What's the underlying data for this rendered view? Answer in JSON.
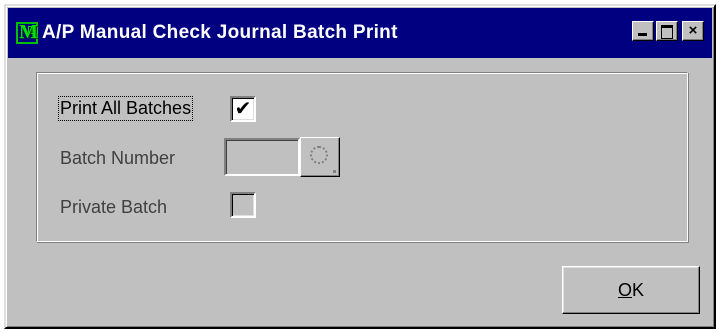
{
  "window": {
    "title": "A/P Manual Check Journal Batch Print",
    "icon": "app-m-icon",
    "controls": {
      "minimize": "minimize-icon",
      "maximize": "maximize-icon",
      "close": "×"
    }
  },
  "form": {
    "print_all_batches": {
      "label": "Print All Batches",
      "checked": true,
      "mark": "✔"
    },
    "batch_number": {
      "label": "Batch Number",
      "value": ""
    },
    "private_batch": {
      "label": "Private Batch",
      "checked": false,
      "mark": ""
    }
  },
  "buttons": {
    "ok_first": "O",
    "ok_rest": "K"
  },
  "colors": {
    "titlebar": "#000080",
    "face": "#c0c0c0",
    "title_text": "#ffffff"
  }
}
